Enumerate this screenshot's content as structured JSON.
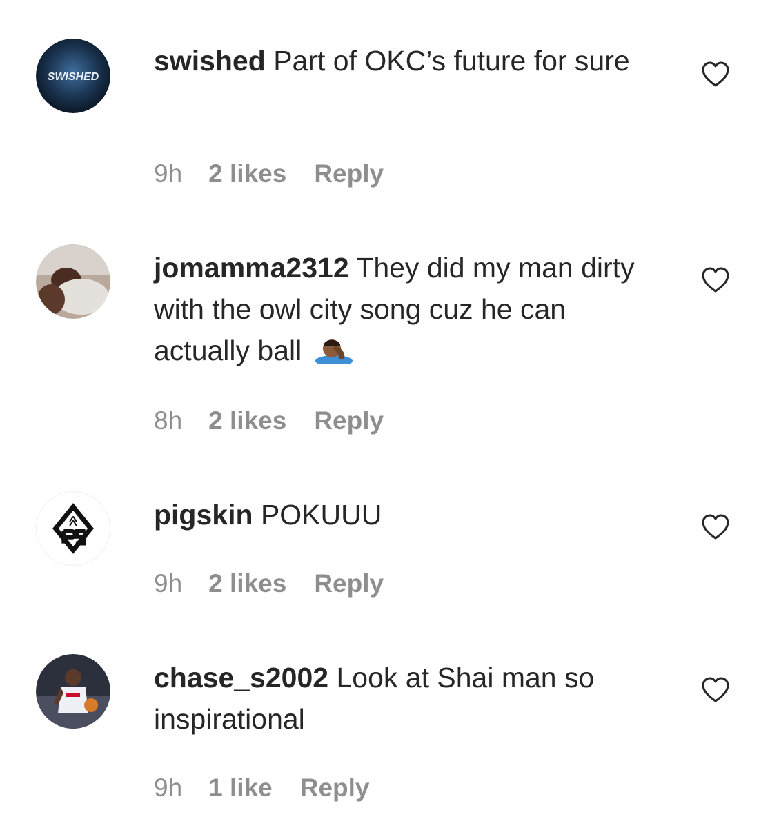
{
  "comments": [
    {
      "username": "swished",
      "text": "Part of OKC’s future for sure",
      "time": "9h",
      "likes": "2 likes",
      "reply": "Reply",
      "avatar_label": "SWISHED"
    },
    {
      "username": "jomamma2312",
      "text": "They did my man dirty with the owl city song cuz he can actually ball",
      "emoji": "facepalm-emoji",
      "time": "8h",
      "likes": "2 likes",
      "reply": "Reply"
    },
    {
      "username": "pigskin",
      "text": "POKUUU",
      "time": "9h",
      "likes": "2 likes",
      "reply": "Reply"
    },
    {
      "username": "chase_s2002",
      "text": "Look at Shai man so inspirational",
      "time": "9h",
      "likes": "1 like",
      "reply": "Reply"
    }
  ],
  "icons": {
    "like": "heart-outline-icon"
  },
  "colors": {
    "text": "#262626",
    "meta": "#8e8e8e"
  }
}
